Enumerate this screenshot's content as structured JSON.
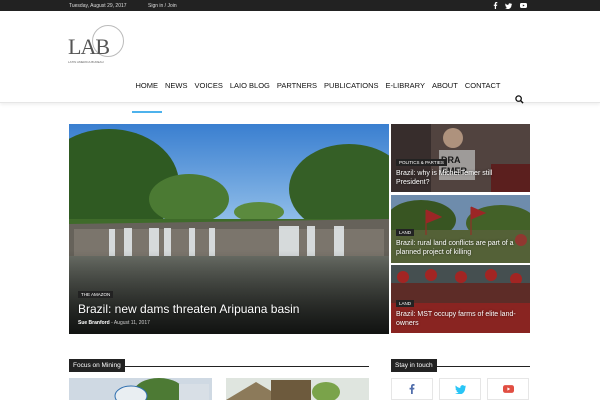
{
  "topbar": {
    "date": "Tuesday, August 29, 2017",
    "signin": "Sign in / Join",
    "social_icons": [
      "facebook-icon",
      "twitter-icon",
      "youtube-icon"
    ]
  },
  "logo": {
    "mark": "LAB",
    "tagline": "LATIN AMERICA BUREAU"
  },
  "nav": {
    "items": [
      "HOME",
      "NEWS",
      "VOICES",
      "LAIO BLOG",
      "PARTNERS",
      "PUBLICATIONS",
      "E-LIBRARY",
      "ABOUT",
      "CONTACT"
    ],
    "active": "HOME",
    "accent": "#4db2ec"
  },
  "hero": {
    "category": "THE AMAZON",
    "title": "Brazil: new dams threaten Aripuana basin",
    "author": "Sue Branford",
    "date": "August 11, 2017"
  },
  "side_posts": [
    {
      "category": "POLITICS & PARTIES",
      "title": "Brazil: why is Michel Temer still President?"
    },
    {
      "category": "LAND",
      "title": "Brazil: rural land conflicts are part of a planned project of killing"
    },
    {
      "category": "LAND",
      "title": "Brazil: MST occupy farms of elite land-owners"
    }
  ],
  "sections": {
    "focus": "Focus on Mining",
    "stay": "Stay in touch"
  },
  "colors": {
    "facebook": "#516eab",
    "twitter": "#29c5f6",
    "youtube": "#e14e42"
  }
}
